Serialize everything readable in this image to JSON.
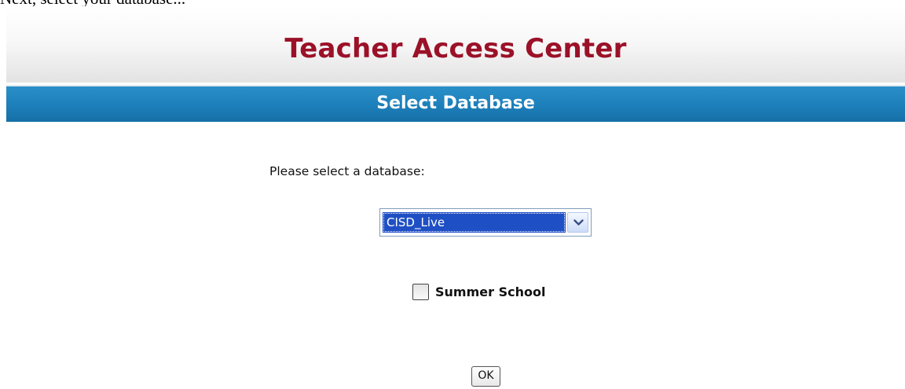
{
  "caption": "Next, select your database...",
  "header": {
    "title": "Teacher Access Center"
  },
  "section": {
    "title": "Select Database"
  },
  "form": {
    "prompt_label": "Please select a database:",
    "database_select": {
      "selected_value": "CISD_Live"
    },
    "summer_school": {
      "label": "Summer School",
      "checked": false
    },
    "ok_label": "OK"
  },
  "colors": {
    "title_red": "#9b1128",
    "bar_blue": "#1d7fba",
    "selection_blue": "#1f4fc4"
  },
  "icons": {
    "dropdown": "chevron-down-icon"
  }
}
